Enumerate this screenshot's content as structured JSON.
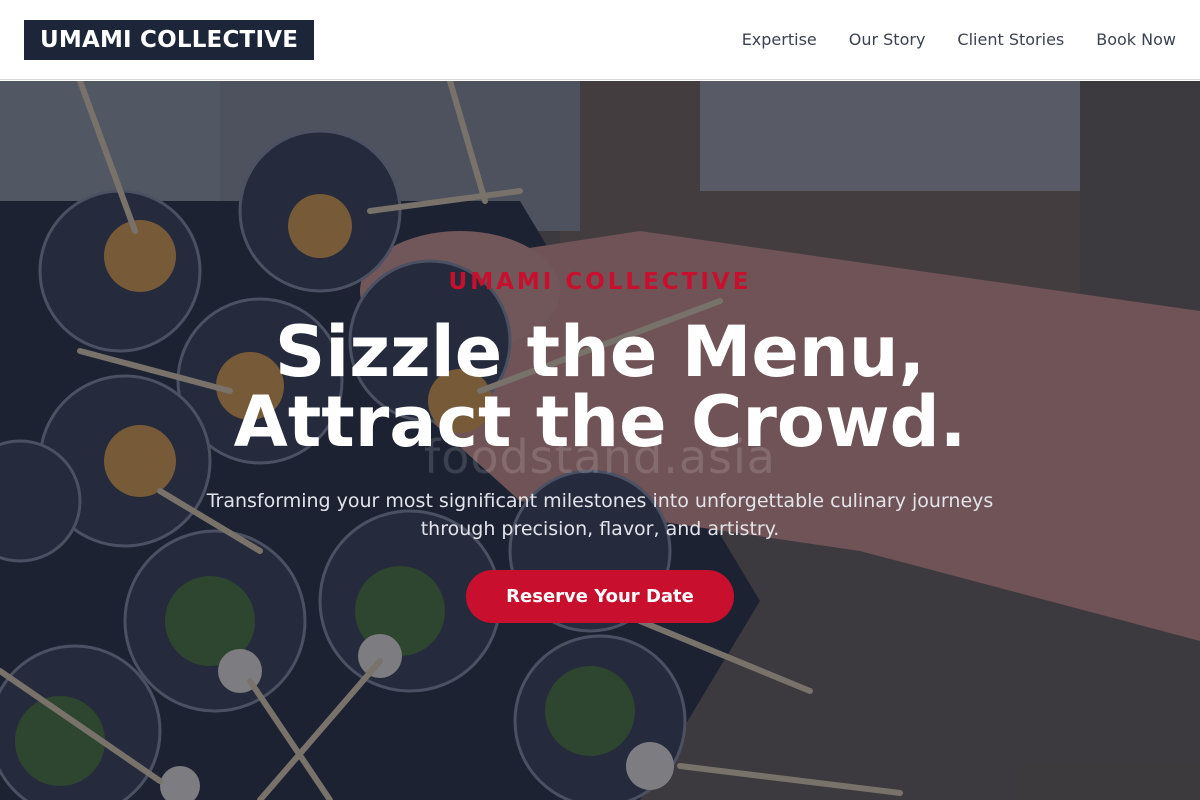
{
  "header": {
    "logo": "UMAMI COLLECTIVE",
    "nav": [
      "Expertise",
      "Our Story",
      "Client Stories",
      "Book Now"
    ]
  },
  "hero": {
    "eyebrow": "UMAMI COLLECTIVE",
    "headline_line1": "Sizzle the Menu,",
    "headline_line2": "Attract the Crowd.",
    "subtitle_line1": "Transforming your most significant milestones into unforgettable culinary journeys",
    "subtitle_line2": "through precision, flavor, and artistry.",
    "cta": "Reserve Your Date",
    "watermark": "foodstand.asia"
  },
  "colors": {
    "navy": "#1d2538",
    "accent_red": "#c8102e",
    "white": "#ffffff"
  }
}
